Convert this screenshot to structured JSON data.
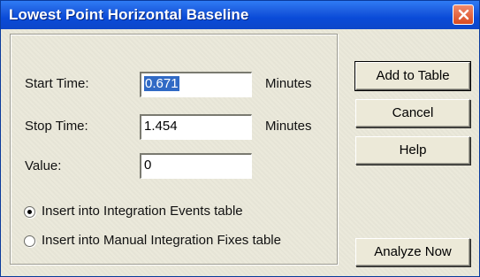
{
  "window": {
    "title": "Lowest Point Horizontal Baseline",
    "close_icon": "close-icon"
  },
  "form": {
    "start_time": {
      "label": "Start Time:",
      "value": "0.671",
      "unit": "Minutes",
      "selected": true
    },
    "stop_time": {
      "label": "Stop Time:",
      "value": "1.454",
      "unit": "Minutes"
    },
    "value": {
      "label": "Value:",
      "value": "0"
    }
  },
  "options": [
    {
      "label": "Insert into Integration Events table",
      "checked": true
    },
    {
      "label": "Insert into Manual Integration Fixes table",
      "checked": false
    }
  ],
  "buttons": {
    "add_to_table": "Add to Table",
    "cancel": "Cancel",
    "help": "Help",
    "analyze_now": "Analyze Now"
  },
  "colors": {
    "titlebar": "#0a4bd8",
    "close_button": "#d94a20",
    "dialog_face": "#ece9d8",
    "selection": "#316ac5"
  }
}
